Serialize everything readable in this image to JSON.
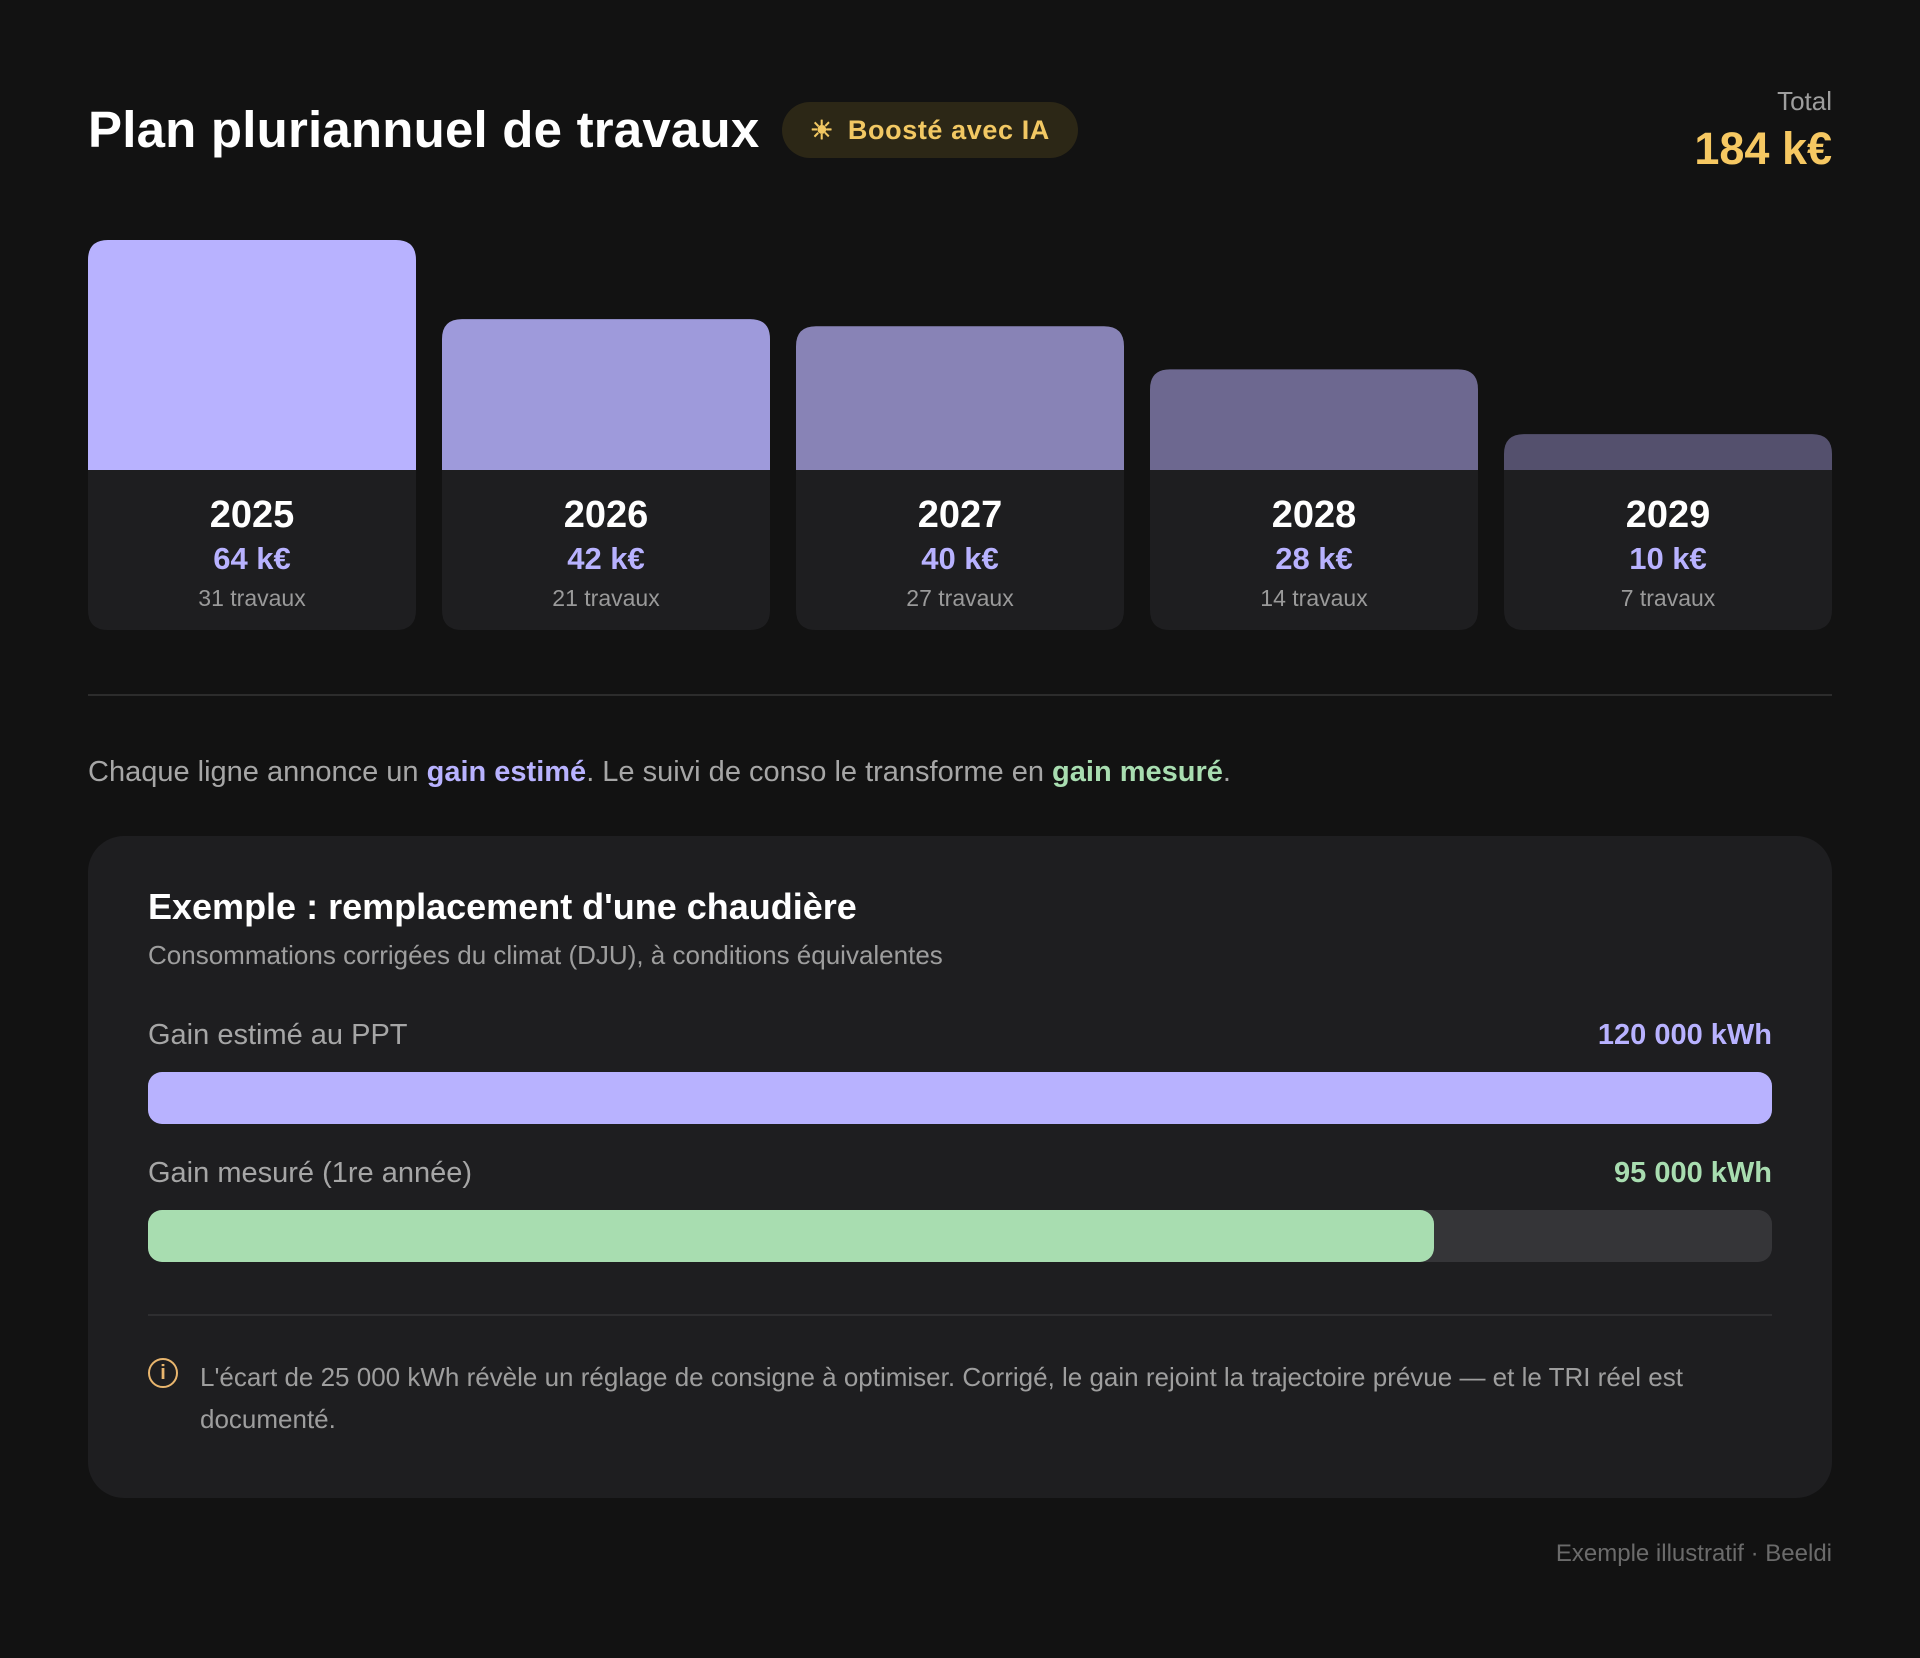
{
  "header": {
    "title": "Plan pluriannuel de travaux",
    "badge_icon": "sun-icon",
    "badge_glyph": "☀",
    "badge_label": "Boosté avec IA",
    "total_label": "Total",
    "total_value": "184 k€"
  },
  "chart_data": {
    "type": "bar",
    "categories": [
      "2025",
      "2026",
      "2027",
      "2028",
      "2029"
    ],
    "values": [
      64,
      42,
      40,
      28,
      10
    ],
    "value_labels": [
      "64 k€",
      "42 k€",
      "40 k€",
      "28 k€",
      "10 k€"
    ],
    "counts": [
      "31 travaux",
      "21 travaux",
      "27 travaux",
      "14 travaux",
      "7 travaux"
    ],
    "colors": [
      "#b8b2ff",
      "#9e9adb",
      "#8883b6",
      "#6d6890",
      "#54506d"
    ],
    "info_background": "#1e1e20",
    "ylim": [
      0,
      64
    ]
  },
  "intro": {
    "part1": "Chaque ligne annonce un ",
    "est": "gain estimé",
    "part2": ". Le suivi de conso le transforme en ",
    "mes": "gain mesuré",
    "part3": "."
  },
  "example": {
    "title": "Exemple : remplacement d'une chaudière",
    "subtitle": "Consommations corrigées du climat (DJU), à conditions équivalentes",
    "metrics": [
      {
        "label": "Gain estimé au PPT",
        "value": "120 000 kWh",
        "amount": 120000,
        "max": 120000,
        "color": "#b8b2ff"
      },
      {
        "label": "Gain mesuré (1re année)",
        "value": "95 000 kWh",
        "amount": 95000,
        "max": 120000,
        "color": "#a8ddb0"
      }
    ],
    "note_icon": "info-icon",
    "note_glyph": "i",
    "note": "L'écart de 25 000 kWh révèle un réglage de consigne à optimiser. Corrigé, le gain rejoint la trajectoire prévue — et le TRI réel est documenté."
  },
  "footer": "Exemple illustratif · Beeldi"
}
